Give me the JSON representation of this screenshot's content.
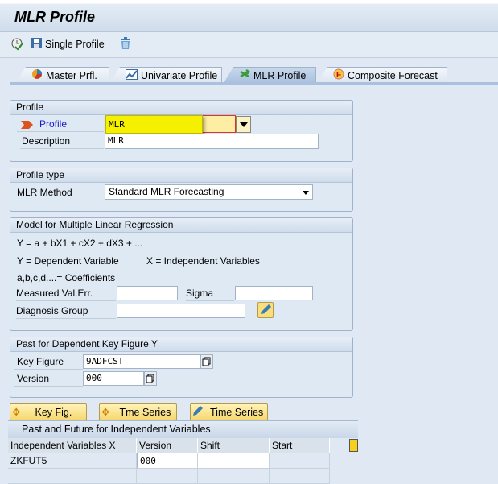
{
  "title": "MLR Profile",
  "toolbar": {
    "single_profile": "Single Profile"
  },
  "tabs": [
    {
      "label": "Master Prfl."
    },
    {
      "label": "Univariate Profile"
    },
    {
      "label": "MLR Profile"
    },
    {
      "label": "Composite Forecast"
    }
  ],
  "profile_group": {
    "header": "Profile",
    "profile_label": "Profile",
    "profile_value": "MLR",
    "description_label": "Description",
    "description_value": "MLR"
  },
  "profile_type": {
    "header": "Profile type",
    "method_label": "MLR Method",
    "method_value": "Standard MLR Forecasting"
  },
  "model": {
    "header": "Model for Multiple Linear Regression",
    "formula": "Y = a + bX1 + cX2 + dX3 + ...",
    "dependent": "Y = Dependent Variable",
    "independent": "X = Independent Variables",
    "coefficients": "a,b,c,d....= Coefficients",
    "measured_label": "Measured Val.Err.",
    "measured_value": "",
    "sigma_label": "Sigma",
    "sigma_value": "",
    "diagnosis_label": "Diagnosis Group",
    "diagnosis_value": ""
  },
  "past": {
    "header": "Past for Dependent Key Figure Y",
    "key_figure_label": "Key Figure",
    "key_figure_value": "9ADFCST",
    "version_label": "Version",
    "version_value": "000"
  },
  "buttons": {
    "key_fig": "Key Fig.",
    "tme_series": "Tme Series",
    "time_series": "Time Series"
  },
  "table": {
    "header": "Past and Future for Independent Variables",
    "columns": [
      "Independent Variables X",
      "Version",
      "Shift",
      "Start"
    ],
    "rows": [
      [
        "ZKFUT5",
        "000",
        "",
        ""
      ]
    ]
  }
}
